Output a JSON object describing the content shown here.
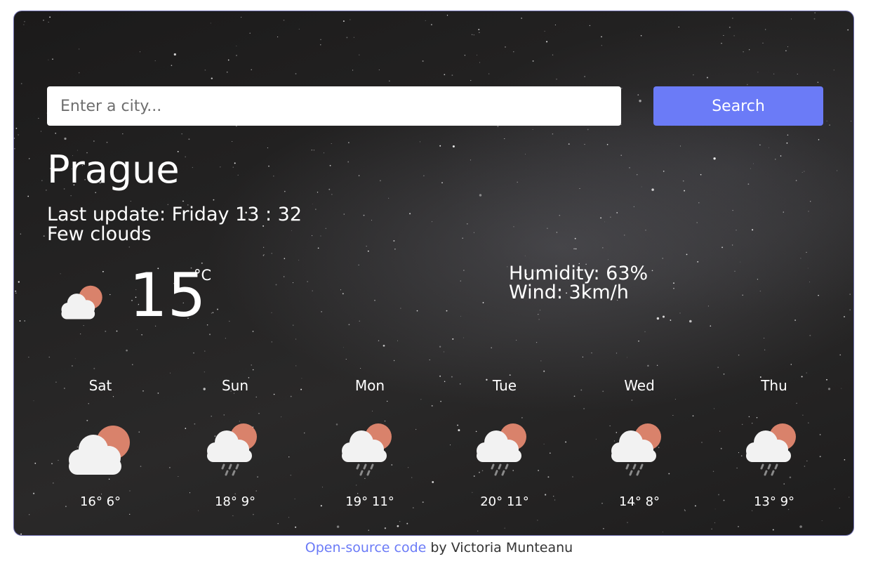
{
  "search": {
    "placeholder": "Enter a city...",
    "button_label": "Search"
  },
  "current": {
    "city": "Prague",
    "last_update": "Last update: Friday 13 : 32",
    "description": "Few clouds",
    "temperature": "15",
    "unit": "°C",
    "humidity": "Humidity: 63%",
    "wind": "Wind: 3km/h",
    "icon": "few-clouds-day-icon"
  },
  "forecast": [
    {
      "day": "Sat",
      "temps": "16° 6°",
      "icon": "few-clouds-day-icon"
    },
    {
      "day": "Sun",
      "temps": "18° 9°",
      "icon": "rain-day-icon"
    },
    {
      "day": "Mon",
      "temps": "19° 11°",
      "icon": "rain-day-icon"
    },
    {
      "day": "Tue",
      "temps": "20° 11°",
      "icon": "rain-day-icon"
    },
    {
      "day": "Wed",
      "temps": "14° 8°",
      "icon": "rain-day-icon"
    },
    {
      "day": "Thu",
      "temps": "13° 9°",
      "icon": "rain-day-icon"
    }
  ],
  "footer": {
    "link_text": "Open-source code",
    "credit": " by Victoria Munteanu"
  },
  "colors": {
    "accent": "#6b7bf7",
    "sun": "#d9826b",
    "cloud": "#f2f2f2",
    "rain": "#8a8a8a"
  }
}
